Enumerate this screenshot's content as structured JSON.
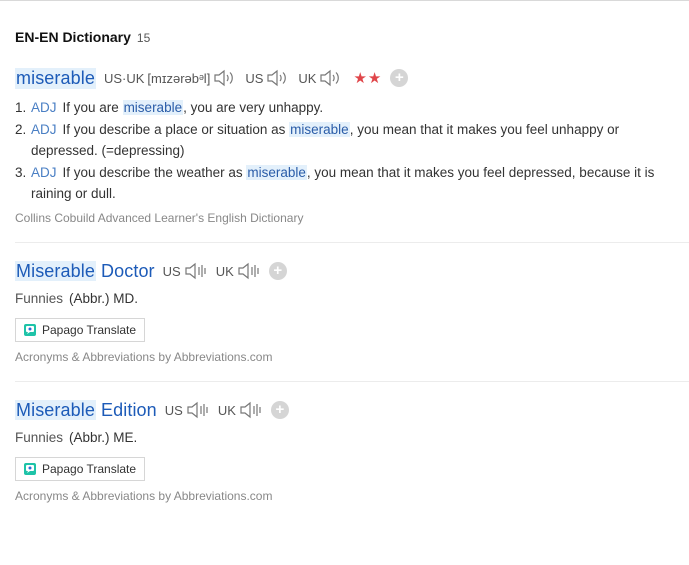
{
  "header": {
    "title": "EN-EN Dictionary",
    "count": "15"
  },
  "entry1": {
    "word": "miserable",
    "pron_label": "US·UK",
    "ipa": "[mɪzərəbᵊl]",
    "us_label": "US",
    "uk_label": "UK",
    "stars": "★★",
    "plus": "+",
    "definitions": [
      {
        "num": "1.",
        "pos": "ADJ",
        "before": "If you are ",
        "hl": "miserable",
        "after": ", you are very unhappy."
      },
      {
        "num": "2.",
        "pos": "ADJ",
        "before": "If you describe a place or situation as ",
        "hl": "miserable",
        "after": ", you mean that it makes you feel unhappy or depressed. (=depressing)"
      },
      {
        "num": "3.",
        "pos": "ADJ",
        "before": "If you describe the weather as ",
        "hl": "miserable",
        "after": ", you mean that it makes you feel depressed, because it is raining or dull."
      }
    ],
    "source": "Collins Cobuild Advanced Learner's English Dictionary"
  },
  "entry2": {
    "word_hl": "Miserable",
    "word_rest": " Doctor",
    "us_label": "US",
    "uk_label": "UK",
    "plus": "+",
    "category": "Funnies",
    "meaning": "(Abbr.) MD.",
    "translate_label": "Papago Translate",
    "source": "Acronyms & Abbreviations by Abbreviations.com"
  },
  "entry3": {
    "word_hl": "Miserable",
    "word_rest": " Edition",
    "us_label": "US",
    "uk_label": "UK",
    "plus": "+",
    "category": "Funnies",
    "meaning": "(Abbr.) ME.",
    "translate_label": "Papago Translate",
    "source": "Acronyms & Abbreviations by Abbreviations.com"
  },
  "icons": {
    "speaker": "speaker-icon",
    "papago": "papago-icon",
    "plus": "plus-icon"
  },
  "colors": {
    "link": "#1d5bb8",
    "highlight_bg": "#e3f0fb",
    "stars": "#e0464a",
    "pos": "#4a7fc4"
  }
}
